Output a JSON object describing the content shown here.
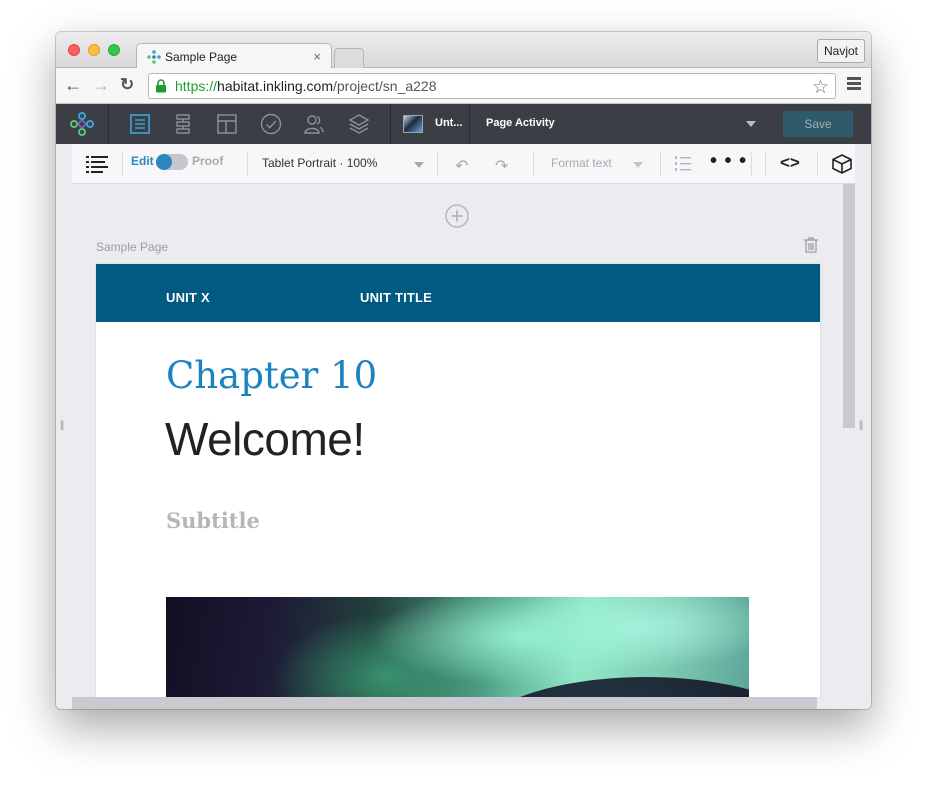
{
  "browser": {
    "tab_title": "Sample Page",
    "tab_close": "×",
    "profile_name": "Navjot",
    "url_scheme": "https://",
    "url_host": "habitat.inkling.com",
    "url_path": "/project/sn_a228"
  },
  "app_toolbar": {
    "document_name": "Unt...",
    "activity_label": "Page Activity",
    "save_label": "Save"
  },
  "edit_toolbar": {
    "edit_label": "Edit",
    "proof_label": "Proof",
    "mode": "edit",
    "device_label": "Tablet Portrait · 100%",
    "format_label": "Format text",
    "more_label": "• • •",
    "code_label": "<>"
  },
  "canvas": {
    "page_label": "Sample Page"
  },
  "content": {
    "unit_label": "UNIT X",
    "unit_title": "UNIT TITLE",
    "chapter": "Chapter 10",
    "heading": "Welcome!",
    "subtitle": "Subtitle"
  },
  "colors": {
    "app_bar": "#3b3e45",
    "accent_blue": "#2a87c0",
    "banner": "#015a82",
    "chapter_text": "#1a83c0",
    "save_button": "#2f5a6a"
  }
}
